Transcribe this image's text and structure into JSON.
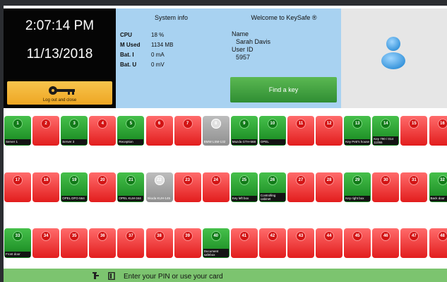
{
  "clock": {
    "time": "2:07:14 PM",
    "date": "11/13/2018"
  },
  "logout": {
    "label": "Log out and close",
    "icon": "key-icon"
  },
  "system_info": {
    "title": "System info",
    "rows": [
      {
        "key": "CPU",
        "value": "18 %"
      },
      {
        "key": "M Used",
        "value": "1134 MB"
      },
      {
        "key": "Bat. I",
        "value": "0 mA"
      },
      {
        "key": "Bat. U",
        "value": "0 mV"
      }
    ]
  },
  "welcome": {
    "title": "Welcome to KeySafe ®",
    "name_label": "Name",
    "name": "Sarah Davis",
    "userid_label": "User ID",
    "userid": "5957",
    "find_key_label": "Find a key"
  },
  "avatar": {
    "icon": "user-avatar-icon",
    "color": "#4aa8e8"
  },
  "colors": {
    "red": "#e21d1d",
    "green": "#15851e",
    "grey": "#9e9e9e",
    "status_bar": "#7cc46f"
  },
  "keys": [
    {
      "n": "1",
      "s": "green",
      "label": "Server 1"
    },
    {
      "n": "2",
      "s": "red",
      "label": ""
    },
    {
      "n": "3",
      "s": "green",
      "label": "Server 3"
    },
    {
      "n": "4",
      "s": "red",
      "label": ""
    },
    {
      "n": "5",
      "s": "green",
      "label": "Reception"
    },
    {
      "n": "6",
      "s": "red",
      "label": ""
    },
    {
      "n": "7",
      "s": "red",
      "label": ""
    },
    {
      "n": "8",
      "s": "grey",
      "label": "BMW LSM-132"
    },
    {
      "n": "9",
      "s": "green",
      "label": "Mazda GTH-568"
    },
    {
      "n": "10",
      "s": "green",
      "label": "OPEL"
    },
    {
      "n": "11",
      "s": "red",
      "label": ""
    },
    {
      "n": "12",
      "s": "red",
      "label": ""
    },
    {
      "n": "13",
      "s": "green",
      "label": "Key Petr's house"
    },
    {
      "n": "14",
      "s": "green",
      "label": "Key 790 / 014 11055"
    },
    {
      "n": "15",
      "s": "red",
      "label": ""
    },
    {
      "n": "16",
      "s": "red",
      "label": ""
    },
    {
      "n": "17",
      "s": "red",
      "label": ""
    },
    {
      "n": "18",
      "s": "red",
      "label": ""
    },
    {
      "n": "19",
      "s": "green",
      "label": "OPEL DFG-564"
    },
    {
      "n": "20",
      "s": "red",
      "label": ""
    },
    {
      "n": "21",
      "s": "green",
      "label": "OPEL KLM-344"
    },
    {
      "n": "22",
      "s": "grey",
      "label": "Skoda KUH-145"
    },
    {
      "n": "23",
      "s": "red",
      "label": ""
    },
    {
      "n": "24",
      "s": "red",
      "label": ""
    },
    {
      "n": "25",
      "s": "green",
      "label": "Key left box"
    },
    {
      "n": "26",
      "s": "green",
      "label": "Controlling cabinet"
    },
    {
      "n": "27",
      "s": "red",
      "label": ""
    },
    {
      "n": "28",
      "s": "red",
      "label": ""
    },
    {
      "n": "29",
      "s": "green",
      "label": "Key right box"
    },
    {
      "n": "30",
      "s": "red",
      "label": ""
    },
    {
      "n": "31",
      "s": "red",
      "label": ""
    },
    {
      "n": "32",
      "s": "green",
      "label": "Back door"
    },
    {
      "n": "33",
      "s": "green",
      "label": "Front door"
    },
    {
      "n": "34",
      "s": "red",
      "label": ""
    },
    {
      "n": "35",
      "s": "red",
      "label": ""
    },
    {
      "n": "36",
      "s": "red",
      "label": ""
    },
    {
      "n": "37",
      "s": "red",
      "label": ""
    },
    {
      "n": "38",
      "s": "red",
      "label": ""
    },
    {
      "n": "39",
      "s": "red",
      "label": ""
    },
    {
      "n": "40",
      "s": "green",
      "label": "Document safebox"
    },
    {
      "n": "41",
      "s": "red",
      "label": ""
    },
    {
      "n": "42",
      "s": "red",
      "label": ""
    },
    {
      "n": "43",
      "s": "red",
      "label": ""
    },
    {
      "n": "44",
      "s": "red",
      "label": ""
    },
    {
      "n": "45",
      "s": "red",
      "label": ""
    },
    {
      "n": "46",
      "s": "red",
      "label": ""
    },
    {
      "n": "47",
      "s": "red",
      "label": ""
    },
    {
      "n": "48",
      "s": "red",
      "label": ""
    }
  ],
  "status_bar": {
    "message": "Enter your PIN or use your card",
    "icons": [
      "hand-keypad-icon",
      "card-icon"
    ]
  }
}
